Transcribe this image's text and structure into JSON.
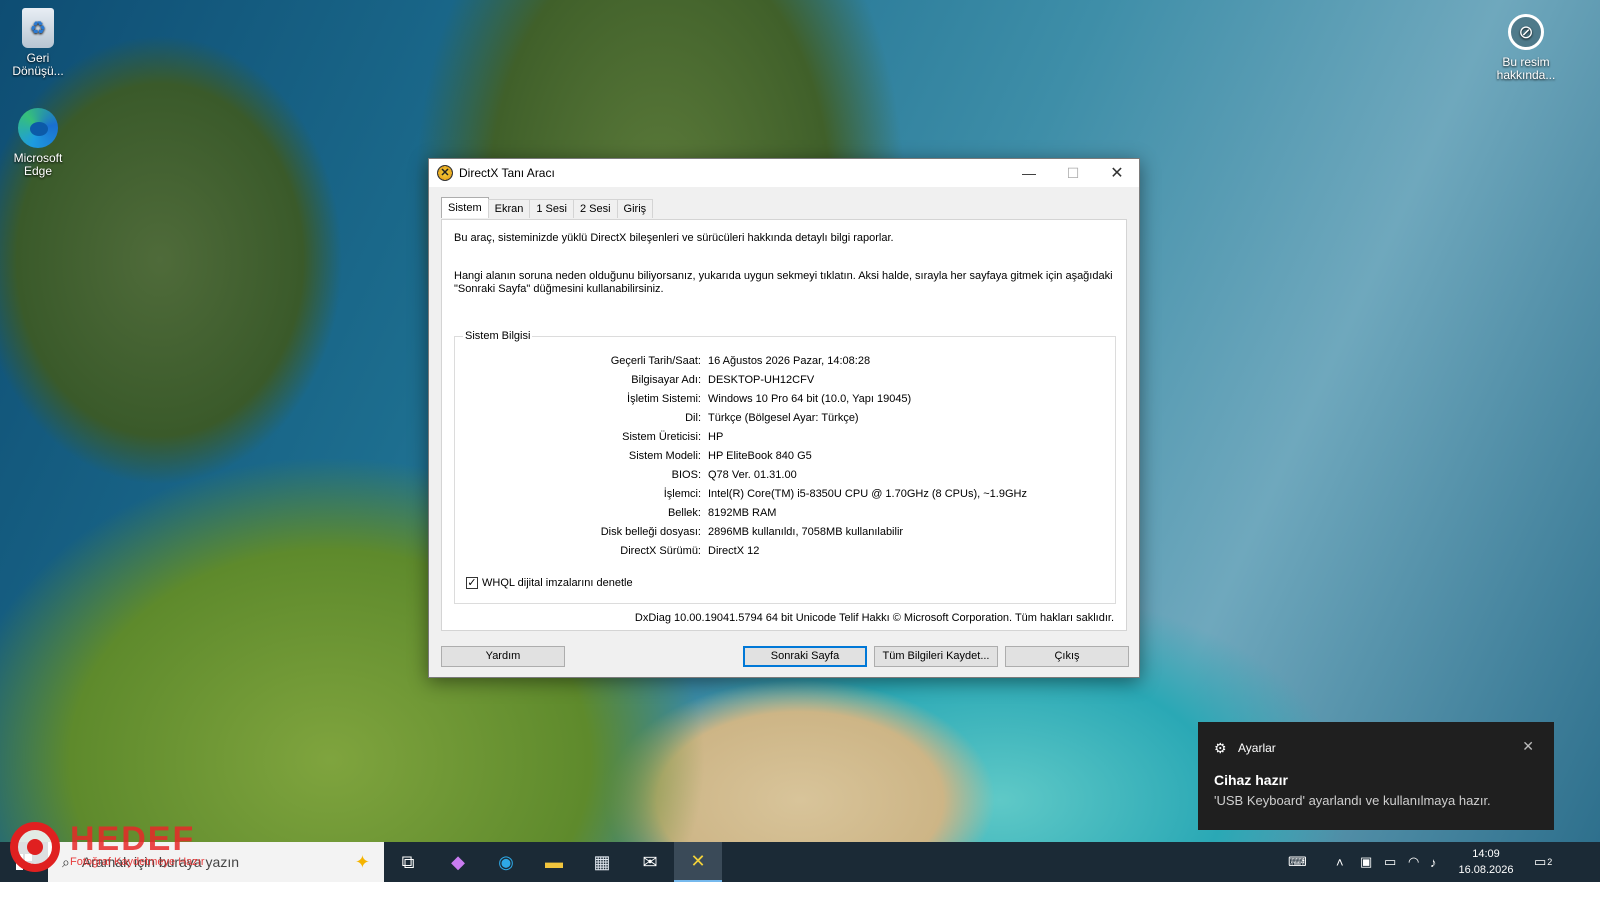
{
  "desktop": {
    "icons": [
      {
        "label": "Geri Dönüşü...",
        "icon": "recycle-bin-icon"
      },
      {
        "label": "Microsoft Edge",
        "icon": "edge-icon"
      },
      {
        "label": "Bu resim hakkında...",
        "icon": "info-icon"
      }
    ]
  },
  "window": {
    "title": "DirectX Tanı Aracı",
    "tabs": [
      "Sistem",
      "Ekran",
      "1 Sesi",
      "2 Sesi",
      "Giriş"
    ],
    "active_tab": "Sistem",
    "intro1": "Bu araç, sisteminizde yüklü DirectX bileşenleri ve sürücüleri hakkında detaylı bilgi raporlar.",
    "intro2": "Hangi alanın soruna neden olduğunu biliyorsanız, yukarıda uygun sekmeyi tıklatın. Aksi halde, sırayla her sayfaya gitmek için aşağıdaki \"Sonraki Sayfa\" düğmesini kullanabilirsiniz.",
    "group_title": "Sistem Bilgisi",
    "info": [
      {
        "label": "Geçerli Tarih/Saat:",
        "value": "16 Ağustos 2026 Pazar, 14:08:28"
      },
      {
        "label": "Bilgisayar Adı:",
        "value": "DESKTOP-UH12CFV"
      },
      {
        "label": "İşletim Sistemi:",
        "value": "Windows 10 Pro 64 bit (10.0, Yapı 19045)"
      },
      {
        "label": "Dil:",
        "value": "Türkçe (Bölgesel Ayar: Türkçe)"
      },
      {
        "label": "Sistem Üreticisi:",
        "value": "HP"
      },
      {
        "label": "Sistem Modeli:",
        "value": "HP EliteBook 840 G5"
      },
      {
        "label": "BIOS:",
        "value": "Q78 Ver. 01.31.00"
      },
      {
        "label": "İşlemci:",
        "value": "Intel(R) Core(TM) i5-8350U CPU @ 1.70GHz (8 CPUs), ~1.9GHz"
      },
      {
        "label": "Bellek:",
        "value": "8192MB RAM"
      },
      {
        "label": "Disk belleği dosyası:",
        "value": "2896MB kullanıldı, 7058MB kullanılabilir"
      },
      {
        "label": "DirectX Sürümü:",
        "value": "DirectX 12"
      }
    ],
    "whql_label": "WHQL dijital imzalarını denetle",
    "whql_checked": true,
    "copyright": "DxDiag 10.00.19041.5794 64 bit Unicode  Telif Hakkı © Microsoft Corporation. Tüm hakları saklıdır.",
    "buttons": {
      "help": "Yardım",
      "next": "Sonraki Sayfa",
      "save": "Tüm Bilgileri Kaydet...",
      "exit": "Çıkış"
    }
  },
  "toast": {
    "app": "Ayarlar",
    "heading": "Cihaz hazır",
    "body": "'USB Keyboard' ayarlandı ve kullanılmaya hazır."
  },
  "taskbar": {
    "search_placeholder": "Aramak için buraya yazın",
    "time": "14:09",
    "date": "16.08.2026",
    "notification_count": "2"
  },
  "watermark": {
    "brand": "HEDEF",
    "sub": "Fotoğraf Kaydetmeye Hazır"
  }
}
